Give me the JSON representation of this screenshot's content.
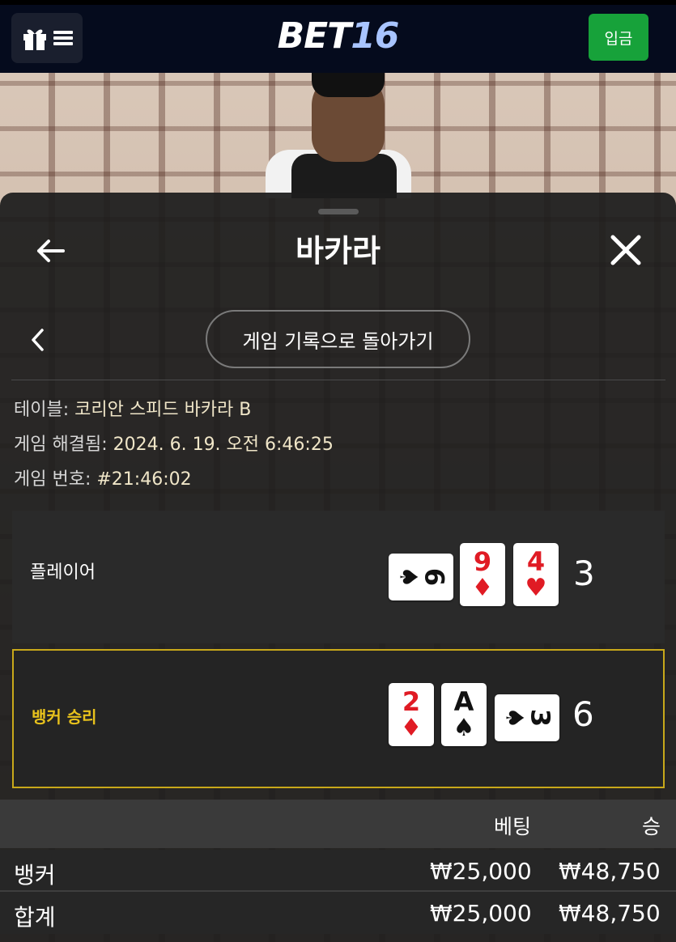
{
  "header": {
    "logo_main": "BET",
    "logo_num": "16",
    "deposit_label": "입금"
  },
  "sheet": {
    "title": "바카라",
    "history_button": "게임 기록으로 돌아가기"
  },
  "info": {
    "table_label": "테이블: ",
    "table_value": "코리안 스피드 바카라 B",
    "resolved_label": "게임 해결됨: ",
    "resolved_value": "2024. 6. 19. 오전 6:46:25",
    "number_label": "게임 번호: ",
    "number_value": "#21:46:02"
  },
  "player": {
    "label": "플레이어",
    "score": "3",
    "cards": [
      {
        "rank": "6",
        "suit": "♠",
        "color": "black",
        "orientation": "sideways"
      },
      {
        "rank": "9",
        "suit": "♦",
        "color": "red",
        "orientation": "upright"
      },
      {
        "rank": "4",
        "suit": "♥",
        "color": "red",
        "orientation": "upright"
      }
    ]
  },
  "banker": {
    "label": "뱅커 승리",
    "score": "6",
    "cards": [
      {
        "rank": "2",
        "suit": "♦",
        "color": "red",
        "orientation": "upright"
      },
      {
        "rank": "A",
        "suit": "♠",
        "color": "black",
        "orientation": "upright"
      },
      {
        "rank": "3",
        "suit": "♠",
        "color": "black",
        "orientation": "sideways"
      }
    ]
  },
  "bets": {
    "col_bet": "베팅",
    "col_win": "승",
    "rows": [
      {
        "name": "뱅커",
        "bet": "₩25,000",
        "win": "₩48,750"
      },
      {
        "name": "합계",
        "bet": "₩25,000",
        "win": "₩48,750"
      }
    ]
  },
  "colors": {
    "accent_green": "#17a23a",
    "winner_gold": "#c8a81a",
    "card_red": "#e01b24"
  }
}
